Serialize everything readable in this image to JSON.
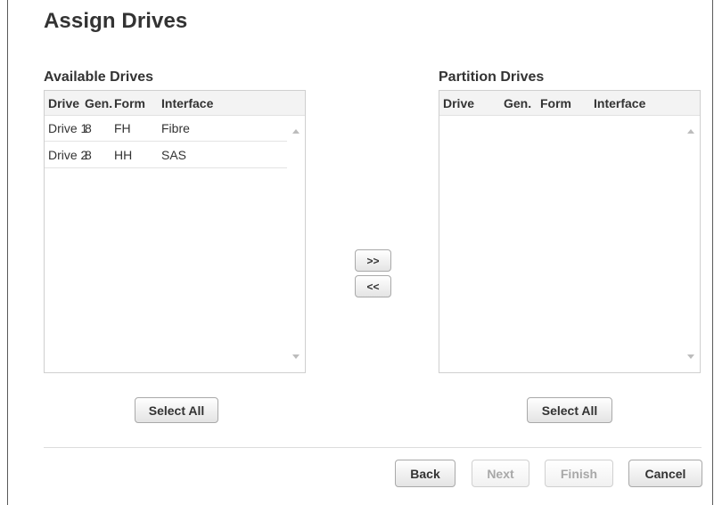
{
  "page": {
    "title": "Assign Drives"
  },
  "available": {
    "label": "Available Drives",
    "columns": [
      "Drive",
      "Gen.",
      "Form",
      "Interface"
    ],
    "rows": [
      {
        "drive": "Drive 1",
        "gen": "8",
        "form": "FH",
        "interface": "Fibre"
      },
      {
        "drive": "Drive 2",
        "gen": "8",
        "form": "HH",
        "interface": "SAS"
      }
    ],
    "select_all_label": "Select All"
  },
  "partition": {
    "label": "Partition Drives",
    "columns": [
      "Drive",
      "Gen.",
      "Form",
      "Interface"
    ],
    "rows": [],
    "select_all_label": "Select All"
  },
  "transfer": {
    "add_label": ">>",
    "remove_label": "<<"
  },
  "footer": {
    "back_label": "Back",
    "next_label": "Next",
    "finish_label": "Finish",
    "cancel_label": "Cancel",
    "next_enabled": false,
    "finish_enabled": false
  },
  "icons": {
    "scroll_up": "chevron-up-icon",
    "scroll_down": "chevron-down-icon"
  },
  "colors": {
    "header_bg": "#f3f3f3",
    "border": "#cfcfcf",
    "disabled_text": "#a8a8a8"
  }
}
